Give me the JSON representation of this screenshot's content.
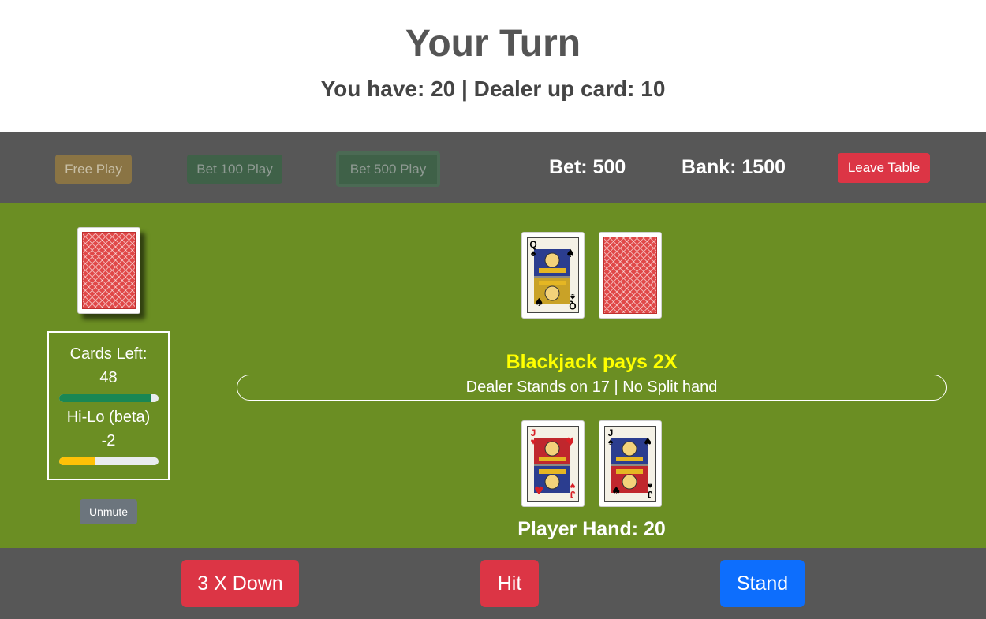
{
  "header": {
    "title": "Your Turn",
    "subtitle": "You have: 20 | Dealer up card: 10"
  },
  "controls": {
    "free_play": "Free Play",
    "bet100": "Bet 100 Play",
    "bet500": "Bet 500 Play",
    "bet": "Bet: 500",
    "bank": "Bank: 1500",
    "leave": "Leave Table"
  },
  "shoe": {
    "cards_left_label": "Cards Left:",
    "cards_left_value": "48",
    "cards_left_fraction": 0.92,
    "hilo_label": "Hi-Lo (beta)",
    "hilo_value": "-2",
    "hilo_fraction": 0.36,
    "colors": {
      "cards_bar": "#198754",
      "hilo_bar": "#ffc107"
    }
  },
  "unmute": "Unmute",
  "dealer": {
    "cards": [
      {
        "rank": "Q",
        "suit": "♠",
        "color": "#000000",
        "face_up": true
      },
      {
        "face_up": false
      }
    ]
  },
  "table_text": {
    "pays": "Blackjack pays 2X",
    "rules": "Dealer Stands on 17 | No Split hand"
  },
  "player": {
    "cards": [
      {
        "rank": "J",
        "suit": "♥",
        "color": "#d81f26",
        "face_up": true
      },
      {
        "rank": "J",
        "suit": "♠",
        "color": "#000000",
        "face_up": true
      }
    ],
    "hand_label": "Player Hand: 20"
  },
  "actions": {
    "double": "3 X Down",
    "hit": "Hit",
    "stand": "Stand"
  },
  "colors": {
    "felt": "#6b8e23",
    "bar": "#575757",
    "danger": "#dc3545",
    "primary": "#0d6efd",
    "highlight": "#ffff00"
  }
}
